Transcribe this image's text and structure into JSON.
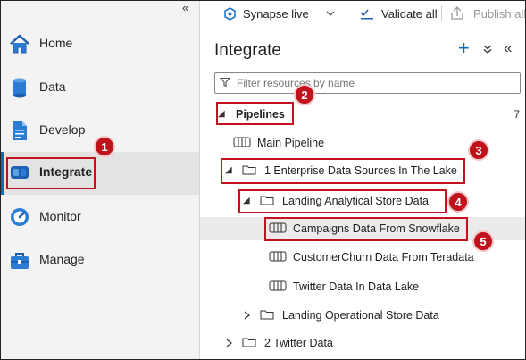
{
  "nav": {
    "collapse_glyph": "«",
    "items": [
      {
        "label": "Home",
        "icon": "home-icon"
      },
      {
        "label": "Data",
        "icon": "database-icon"
      },
      {
        "label": "Develop",
        "icon": "document-icon"
      },
      {
        "label": "Integrate",
        "icon": "pipeline-icon"
      },
      {
        "label": "Monitor",
        "icon": "gauge-icon"
      },
      {
        "label": "Manage",
        "icon": "toolbox-icon"
      }
    ]
  },
  "toolbar": {
    "synapse_live": "Synapse live",
    "validate_all": "Validate all",
    "publish_all": "Publish all"
  },
  "panel": {
    "title": "Integrate",
    "add_glyph": "+",
    "collapse_all_glyph": "⌄",
    "hide_glyph": "«",
    "filter_placeholder": "Filter resources by name"
  },
  "tree": {
    "pipelines_label": "Pipelines",
    "pipelines_count": "7",
    "main_pipeline": "Main Pipeline",
    "folder_1": "1 Enterprise Data Sources In The Lake",
    "folder_landing_analytical": "Landing Analytical Store Data",
    "pipeline_campaigns": "Campaigns Data From Snowflake",
    "pipeline_customerchurn": "CustomerChurn Data From Teradata",
    "pipeline_twitter": "Twitter Data In Data Lake",
    "folder_landing_operational": "Landing Operational Store Data",
    "folder_2": "2 Twitter Data"
  },
  "callouts": [
    "1",
    "2",
    "3",
    "4",
    "5"
  ],
  "colors": {
    "accent": "#0f6cbd",
    "callout_red": "#c0121c"
  }
}
